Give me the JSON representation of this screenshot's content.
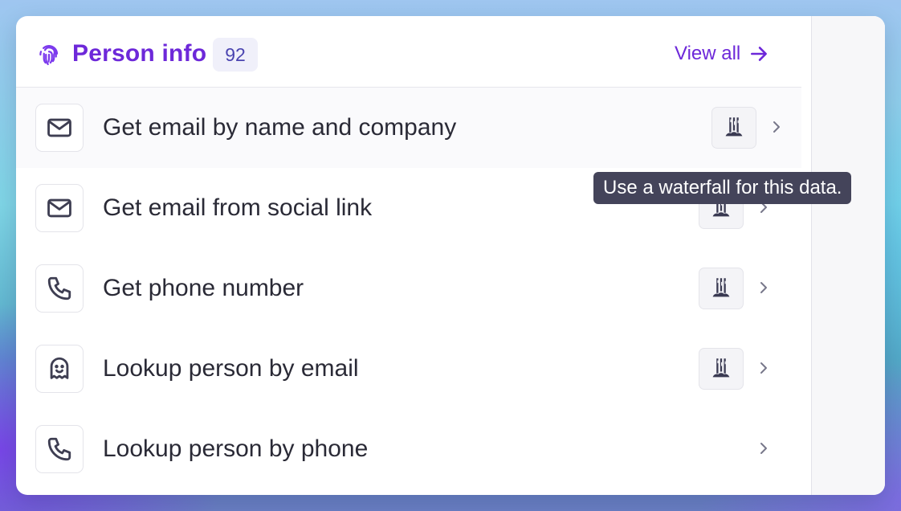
{
  "header": {
    "title": "Person info",
    "count": "92",
    "view_all_label": "View all"
  },
  "rows": [
    {
      "label": "Get email by name and company",
      "icon": "mail-icon",
      "waterfall": true
    },
    {
      "label": "Get email from social link",
      "icon": "mail-icon",
      "waterfall": true
    },
    {
      "label": "Get phone number",
      "icon": "phone-icon",
      "waterfall": true
    },
    {
      "label": "Lookup person by email",
      "icon": "ghost-icon",
      "waterfall": true
    },
    {
      "label": "Lookup person by phone",
      "icon": "phone-icon",
      "waterfall": false
    }
  ],
  "tooltip": {
    "text": "Use a waterfall for this data."
  },
  "colors": {
    "accent": "#6d28d9",
    "tooltip_bg": "#44445a",
    "text": "#2a2a36"
  }
}
